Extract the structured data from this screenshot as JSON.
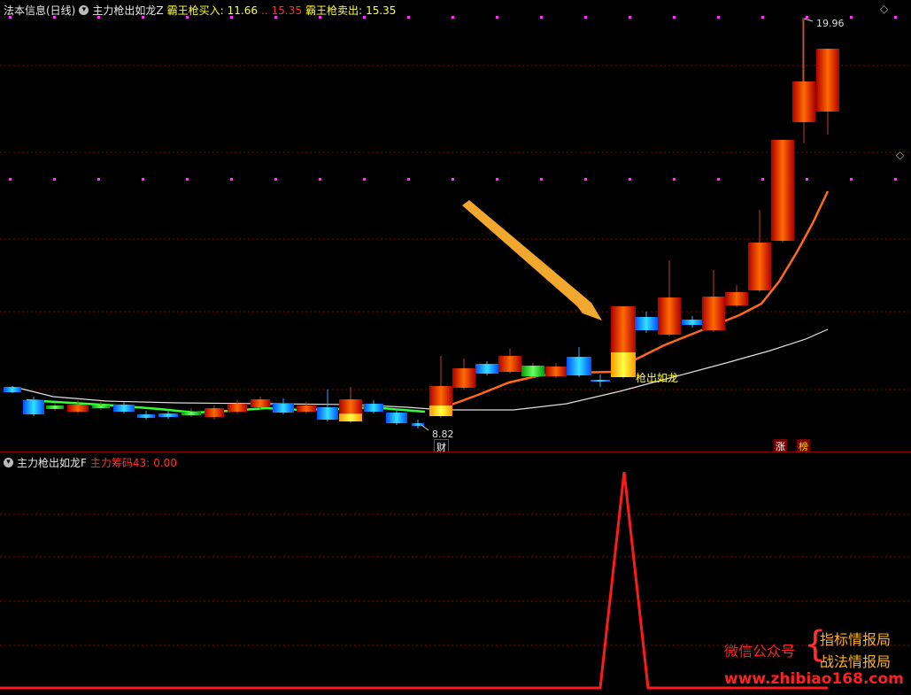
{
  "main_title": {
    "stock_name": "法本信息(日线)",
    "indicator_name": "主力枪出如龙Z",
    "buy_label": "霸王枪买入:",
    "buy_value": "11.66",
    "buy_sep": "..",
    "buy_value2": "15.35",
    "sell_label": "霸王枪卖出:",
    "sell_value": "15.35"
  },
  "sub_title": {
    "indicator_name": "主力枪出如龙F",
    "series_label": "主力筹码43:",
    "series_value": "0.00"
  },
  "chart_annotations": {
    "high_label": "19.96",
    "low_label": "8.82",
    "signal_label": "枪出如龙",
    "marker_cai": "财",
    "marker_zhang": "涨",
    "marker_bang": "榜"
  },
  "watermark": {
    "wechat": "微信公众号",
    "brace": "{",
    "line1": "指标情报局",
    "line2": "战法情报局",
    "url": "www.zhibiao168.com"
  },
  "icons": {
    "corner_top": "◇",
    "corner_mid": "◇"
  },
  "colors": {
    "up": "#ff2a00",
    "down": "#00c8ff",
    "signal": "#ffff33",
    "red_line": "#ff2020",
    "ma_white": "#e0e0e0"
  },
  "chart_data": [
    {
      "type": "candlestick",
      "title": "",
      "high": 19.96,
      "low": 8.82,
      "signal_text": "枪出如龙"
    },
    {
      "type": "line",
      "series": [
        {
          "name": "主力筹码43",
          "last_value": 0.0
        }
      ]
    }
  ]
}
